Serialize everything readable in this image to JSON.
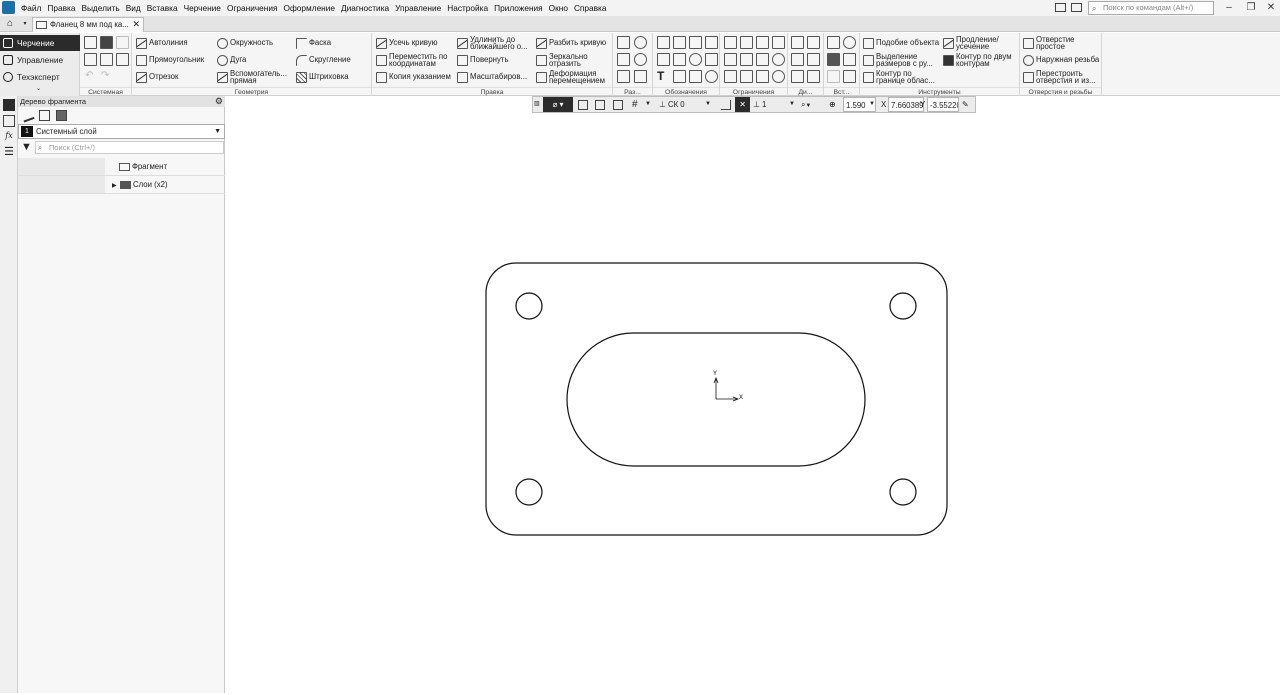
{
  "menubar": {
    "items": [
      "Файл",
      "Правка",
      "Выделить",
      "Вид",
      "Вставка",
      "Черчение",
      "Ограничения",
      "Оформление",
      "Диагностика",
      "Управление",
      "Настройка",
      "Приложения",
      "Окно",
      "Справка"
    ],
    "search_placeholder": "Поиск по командам (Alt+/)"
  },
  "tabbar": {
    "document_tab": "Фланец 8 мм под ка..."
  },
  "modes": [
    "Черчение",
    "Управление",
    "Техэксперт"
  ],
  "ribbon": {
    "groups": [
      "Системная",
      "Геометрия",
      "Правка",
      "Раз...",
      "Обозначения",
      "Ограничения",
      "Ди...",
      "Вст...",
      "Инструменты",
      "Отверстия и резьбы"
    ],
    "geometry": [
      "Автолиния",
      "Прямоугольник",
      "Отрезок",
      "Окружность",
      "Дуга",
      "Вспомогатель... прямая",
      "Фаска",
      "Скругление",
      "Штриховка"
    ],
    "edit": [
      "Усечь кривую",
      "Переместить по координатам",
      "Копия указанием",
      "Удлинить до ближайшего о...",
      "Повернуть",
      "Масштабиров...",
      "Разбить кривую",
      "Зеркально отразить",
      "Деформация перемещением"
    ],
    "tools": [
      "Подобие объекта",
      "Выделение размеров с ру...",
      "Контур по границе облас...",
      "Продление/ усечение",
      "Контур по двум контурам"
    ],
    "holes": [
      "Отверстие простое",
      "Наружная резьба",
      "Перестроить отверстия и из..."
    ]
  },
  "tree_panel": {
    "title": "Дерево фрагмента",
    "layer_number": "1",
    "layer_name": "Системный слой",
    "search_placeholder": "Поиск (Ctrl+/)",
    "rows": [
      {
        "label": "Фрагмент",
        "icon": "fragment-icon"
      },
      {
        "label": "Слои (x2)",
        "icon": "folder-icon"
      }
    ]
  },
  "float_toolbar": {
    "cs": "СК 0",
    "layer": "1",
    "zoom": "1.590",
    "x_label": "X",
    "x_value": "7.660389",
    "y_label": "Y",
    "y_value": "-3.55220"
  },
  "drawing": {
    "axis_x": "X",
    "axis_y": "Y",
    "stroke": "#111111"
  }
}
